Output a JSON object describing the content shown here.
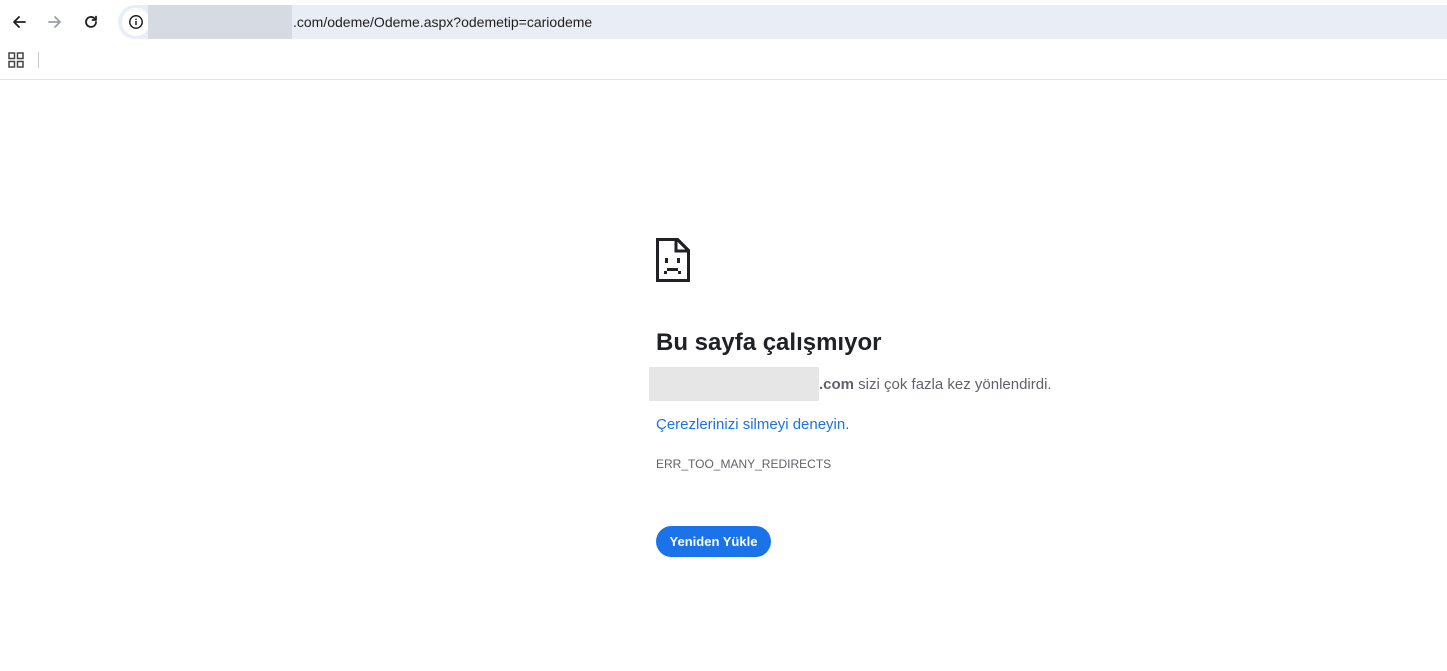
{
  "browser": {
    "url_visible": ".com/odeme/Odeme.aspx?odemetip=cariodeme",
    "nav": {
      "back_icon": "arrow-left-icon",
      "forward_icon": "arrow-right-icon",
      "reload_icon": "reload-icon",
      "info_icon": "info-icon"
    },
    "bookmarks_icon": "apps-grid-icon"
  },
  "error_page": {
    "icon": "sad-page-icon",
    "title": "Bu sayfa çalışmıyor",
    "host_suffix": ".com",
    "message_rest": " sizi çok fazla kez yönlendirdi.",
    "suggestion_link": "Çerezlerinizi silmeyi deneyin",
    "suggestion_end": ".",
    "error_code": "ERR_TOO_MANY_REDIRECTS",
    "reload_button": "Yeniden Yükle"
  },
  "colors": {
    "accent": "#1a73e8",
    "omnibox_bg": "#e9eef6",
    "text_secondary": "#5f6368"
  }
}
